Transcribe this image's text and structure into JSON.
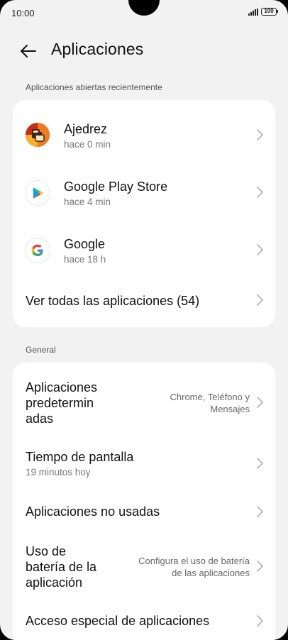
{
  "status_bar": {
    "time": "10:00",
    "battery": "100"
  },
  "header": {
    "title": "Aplicaciones",
    "back_icon": "arrow-left-icon"
  },
  "recent": {
    "section_label": "Aplicaciones abiertas recientemente",
    "apps": [
      {
        "name": "Ajedrez",
        "time": "hace 0 min",
        "icon": "chess-app-icon"
      },
      {
        "name": "Google Play Store",
        "time": "hace 4 min",
        "icon": "play-store-icon"
      },
      {
        "name": "Google",
        "time": "hace 18 h",
        "icon": "google-icon"
      }
    ],
    "see_all": "Ver todas las aplicaciones (54)"
  },
  "general": {
    "section_label": "General",
    "items": [
      {
        "title_lines": [
          "Aplicaciones",
          "predetermin",
          "adas"
        ],
        "value_lines": [
          "Chrome, Teléfono y",
          "Mensajes"
        ]
      },
      {
        "title": "Tiempo de pantalla",
        "subtitle": "19 minutos hoy"
      },
      {
        "title": "Aplicaciones no usadas"
      },
      {
        "title_lines": [
          "Uso de",
          "batería de la",
          "aplicación"
        ],
        "value_lines": [
          "Configura el uso de batería",
          "de las aplicaciones"
        ]
      },
      {
        "title": "Acceso especial de aplicaciones"
      }
    ]
  },
  "colors": {
    "background": "#f2f2f2",
    "card": "#ffffff",
    "text_primary": "#111111",
    "text_secondary": "#777777",
    "chevron": "#b5b5b5"
  }
}
